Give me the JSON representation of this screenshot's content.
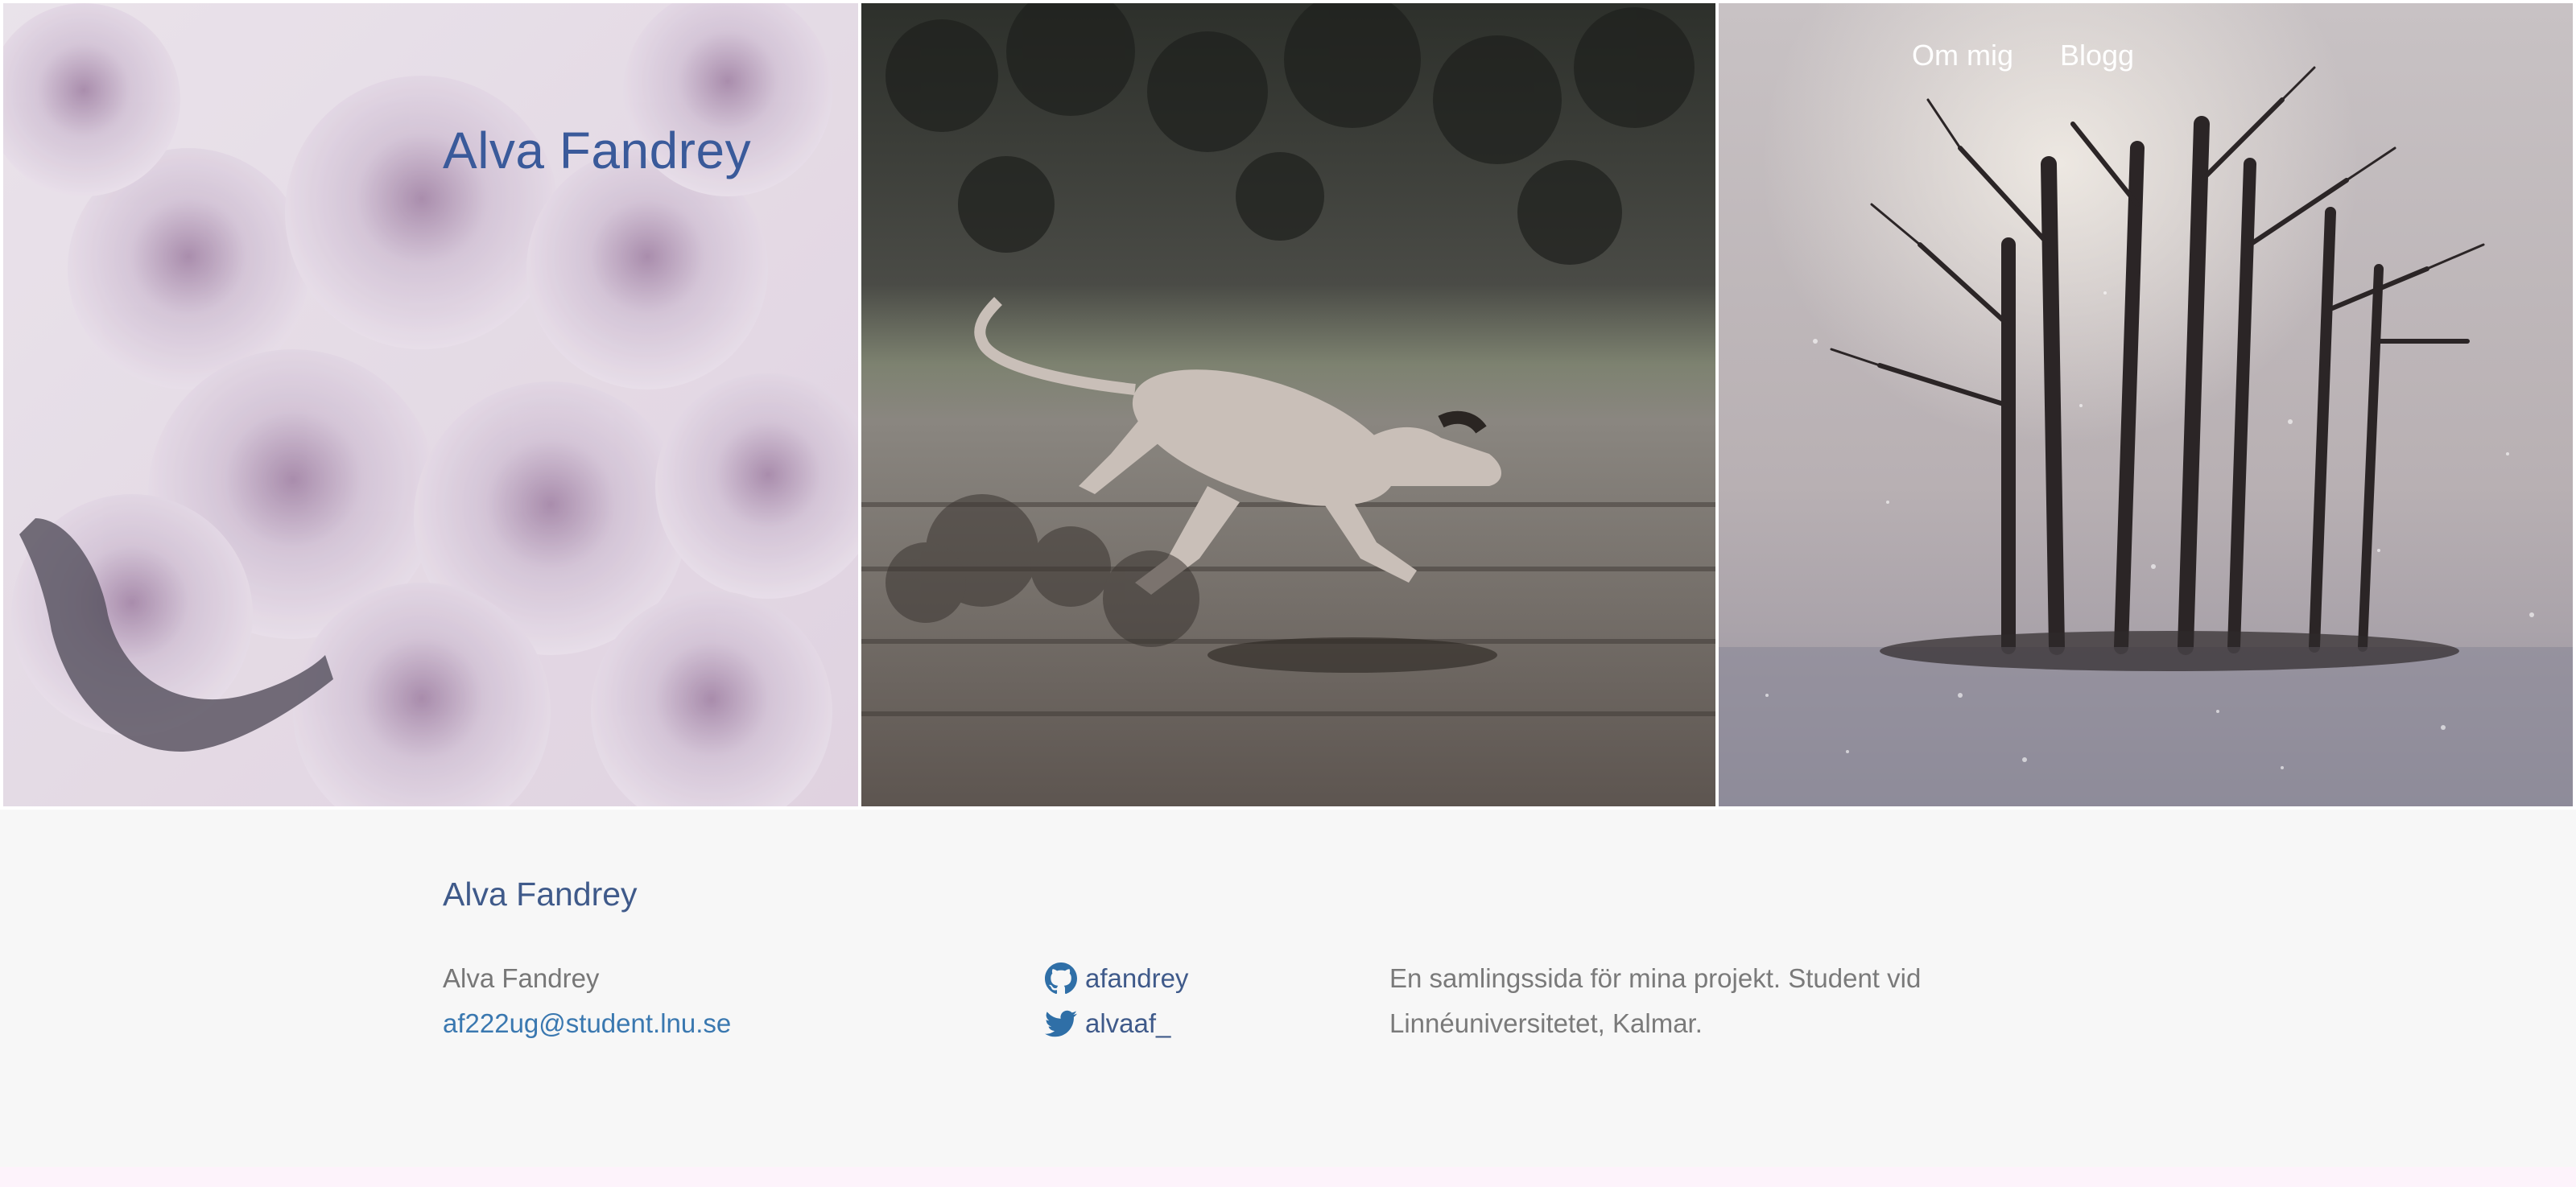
{
  "header": {
    "site_title": "Alva Fandrey",
    "nav": [
      {
        "label": "Om mig"
      },
      {
        "label": "Blogg"
      }
    ]
  },
  "hero_images": [
    {
      "subject": "pale pink peony flowers"
    },
    {
      "subject": "greyhound dog running on dirt track"
    },
    {
      "subject": "bare trees in falling snow"
    }
  ],
  "footer": {
    "title": "Alva Fandrey",
    "name": "Alva Fandrey",
    "email": "af222ug@student.lnu.se",
    "github_user": "afandrey",
    "twitter_user": "alvaaf_",
    "description": "En samlingssida för mina projekt. Student vid Linnéuniversitetet, Kalmar."
  },
  "icons": {
    "github": "github-icon",
    "twitter": "twitter-icon"
  },
  "colors": {
    "accent": "#3a5a9a",
    "link": "#3a78b0",
    "text_muted": "#7a7a7a",
    "background": "#f7f7f7"
  }
}
